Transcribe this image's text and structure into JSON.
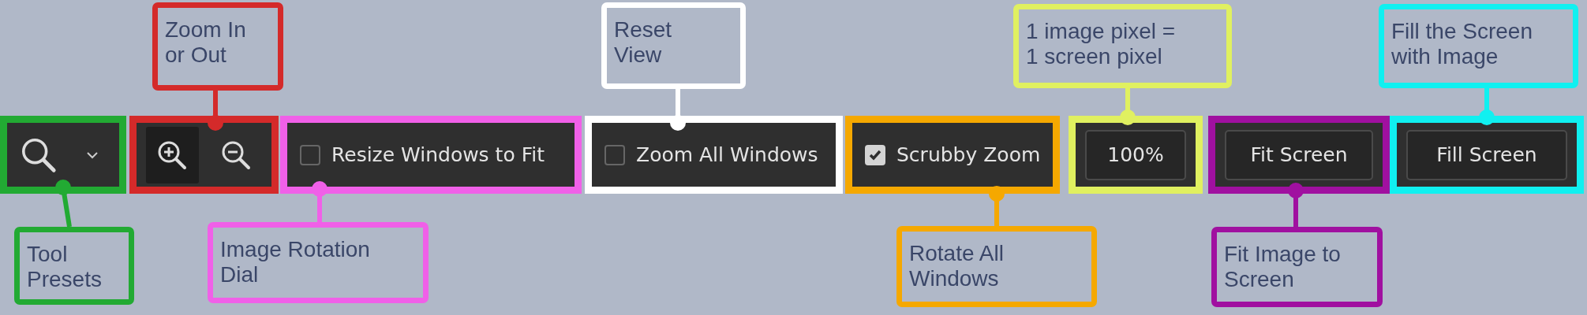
{
  "segments": [
    {
      "kind": "presets",
      "color": "#22aa33",
      "callout": "Tool\nPresets"
    },
    {
      "kind": "zoom_buttons",
      "color": "#d42a2a",
      "callout": "Zoom In\nor Out",
      "buttons": [
        {
          "kind": "zoom_in",
          "selected": true
        },
        {
          "kind": "zoom_out",
          "selected": false
        }
      ]
    },
    {
      "kind": "checkbox",
      "color": "#f060e8",
      "callout": "Image Rotation\nDial",
      "label": "Resize Windows to Fit",
      "checked": false
    },
    {
      "kind": "checkbox",
      "color": "#ffffff",
      "callout": "Reset\nView",
      "label": "Zoom All Windows",
      "checked": false
    },
    {
      "kind": "checkbox",
      "color": "#f5a800",
      "callout": "Rotate All\nWindows",
      "label": "Scrubby Zoom",
      "checked": true
    },
    {
      "kind": "button",
      "color": "#e0f060",
      "callout": "1 image pixel =\n1 screen pixel",
      "label": "100%"
    },
    {
      "kind": "button",
      "color": "#a010a0",
      "callout": "Fit Image to\nScreen",
      "label": "Fit Screen"
    },
    {
      "kind": "button",
      "color": "#10f0f0",
      "callout": "Fill the Screen\nwith Image",
      "label": "Fill Screen"
    }
  ]
}
